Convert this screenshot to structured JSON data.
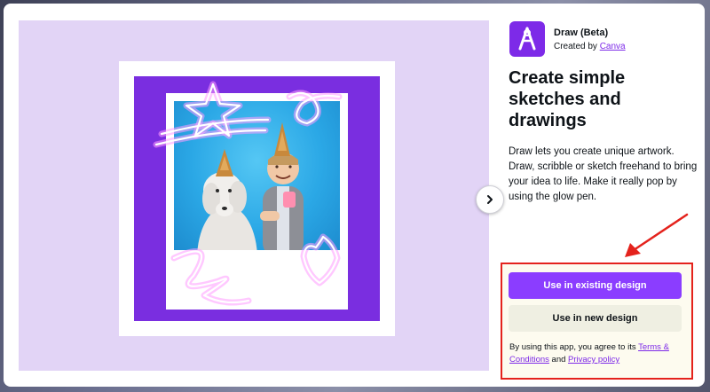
{
  "app": {
    "name": "Draw (Beta)",
    "created_by_prefix": "Created by",
    "creator": "Canva",
    "icon": "draw-app-icon"
  },
  "main": {
    "title": "Create simple sketches and drawings",
    "description": "Draw lets you create unique artwork. Draw, scribble or sketch freehand to bring your idea to life. Make it really pop by using the glow pen."
  },
  "actions": {
    "primary_label": "Use in existing design",
    "secondary_label": "Use in new design"
  },
  "terms": {
    "prefix": "By using this app, you agree to its",
    "terms_link": "Terms & Conditions",
    "and": "and",
    "privacy_link": "Privacy policy"
  },
  "preview": {
    "next_icon": "chevron-right-icon"
  },
  "colors": {
    "accent": "#8b3dff",
    "annotation": "#e4221c",
    "preview_bg": "#e2d4f6",
    "card_purple": "#7a2ee0"
  }
}
